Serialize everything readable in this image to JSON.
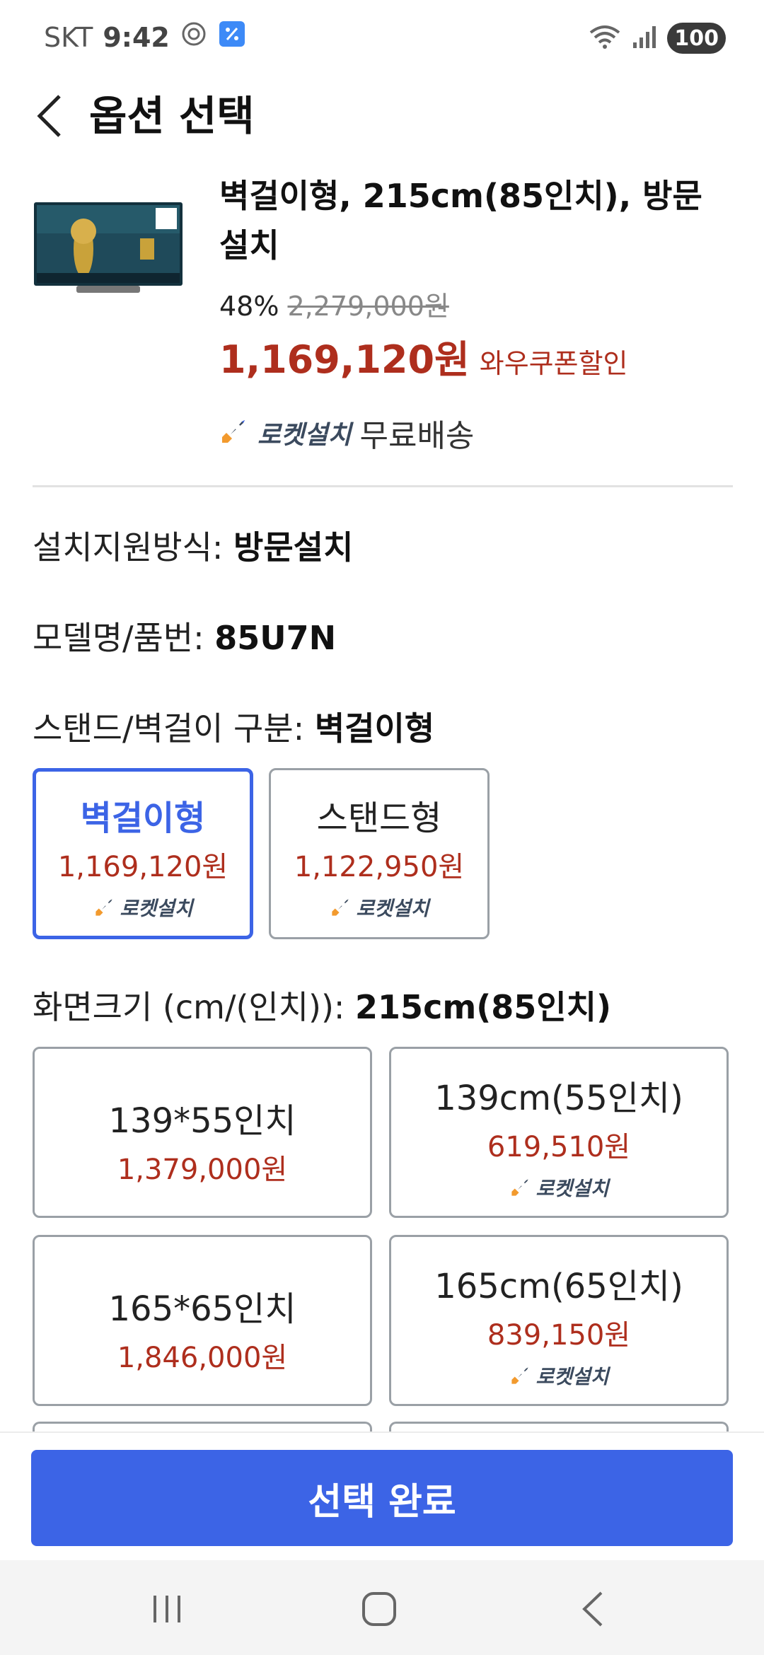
{
  "status_bar": {
    "carrier": "SKT",
    "time": "9:42",
    "battery": "100",
    "icons": [
      "gear-notification-icon",
      "app-notification-icon",
      "wifi-icon",
      "signal-icon",
      "battery-icon"
    ]
  },
  "header": {
    "title": "옵션 선택"
  },
  "product": {
    "name": "벽걸이형, 215cm(85인치), 방문설치",
    "discount": "48%",
    "original_price": "2,279,000원",
    "sale_price": "1,169,120원",
    "coupon_label": "와우쿠폰할인",
    "rocket_label": "로켓설치",
    "shipping": "무료배송"
  },
  "options": {
    "install": {
      "label": "설치지원방식: ",
      "value": "방문설치"
    },
    "model": {
      "label": "모델명/품번: ",
      "value": "85U7N"
    },
    "mount": {
      "label": "스탠드/벽걸이 구분: ",
      "value": "벽걸이형",
      "choices": [
        {
          "name": "벽걸이형",
          "price": "1,169,120원",
          "rocket": "로켓설치",
          "selected": true
        },
        {
          "name": "스탠드형",
          "price": "1,122,950원",
          "rocket": "로켓설치",
          "selected": false
        }
      ]
    },
    "size": {
      "label": "화면크기 (cm/(인치)): ",
      "value": "215cm(85인치)",
      "choices": [
        {
          "name": "139*55인치",
          "price": "1,379,000원"
        },
        {
          "name": "139cm(55인치)",
          "price": "619,510원",
          "rocket": "로켓설치"
        },
        {
          "name": "165*65인치",
          "price": "1,846,000원"
        },
        {
          "name": "165cm(65인치)",
          "price": "839,150원",
          "rocket": "로켓설치"
        }
      ]
    }
  },
  "footer": {
    "confirm_label": "선택 완료"
  },
  "colors": {
    "accent": "#3c64e6",
    "price_red": "#ae2e1d",
    "rocket_blue": "#3b4a5e"
  }
}
